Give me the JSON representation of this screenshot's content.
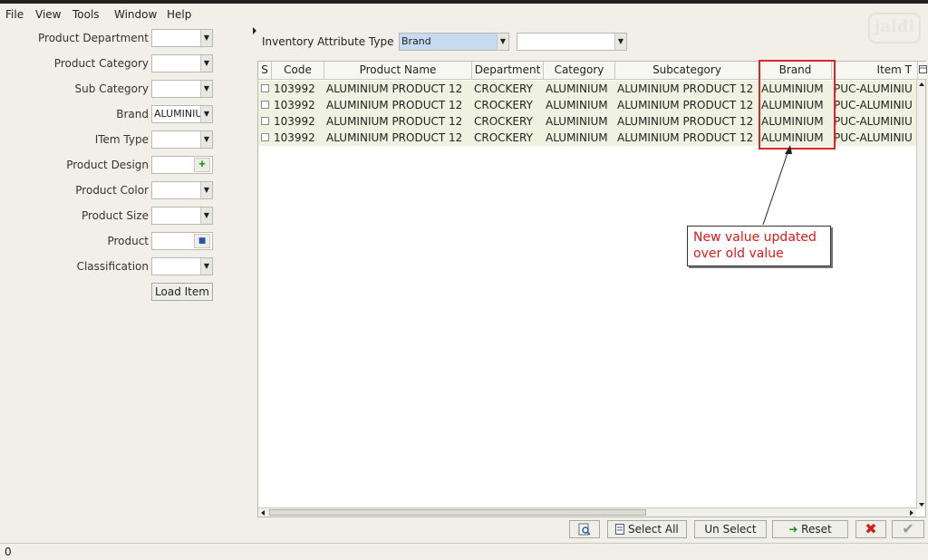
{
  "menu": [
    "File",
    "View",
    "Tools",
    "Window",
    "Help"
  ],
  "logo_text": "jaldi",
  "filters": [
    {
      "label": "Product Department",
      "value": "",
      "kind": "combo"
    },
    {
      "label": "Product Category",
      "value": "",
      "kind": "combo"
    },
    {
      "label": "Sub Category",
      "value": "",
      "kind": "combo"
    },
    {
      "label": "Brand",
      "value": "ALUMINIU",
      "kind": "combo"
    },
    {
      "label": "ITem Type",
      "value": "",
      "kind": "combo"
    },
    {
      "label": "Product Design",
      "value": "",
      "kind": "picker"
    },
    {
      "label": "Product Color",
      "value": "",
      "kind": "combo"
    },
    {
      "label": "Product Size",
      "value": "",
      "kind": "combo"
    },
    {
      "label": "Product",
      "value": "",
      "kind": "picker"
    },
    {
      "label": "Classification",
      "value": "",
      "kind": "combo"
    }
  ],
  "load_item_label": "Load Item",
  "attribute_type": {
    "label": "Inventory Attribute Type",
    "value": "Brand",
    "second_value": ""
  },
  "grid": {
    "columns": [
      "S",
      "Code",
      "Product Name",
      "Department",
      "Category",
      "Subcategory",
      "Brand",
      "Item T"
    ],
    "rows": [
      [
        "",
        "103992",
        "ALUMINIUM PRODUCT 12",
        "CROCKERY",
        "ALUMINIUM",
        "ALUMINIUM PRODUCT 12",
        "ALUMINIUM",
        "PUC-ALUMINIU"
      ],
      [
        "",
        "103992",
        "ALUMINIUM PRODUCT 12",
        "CROCKERY",
        "ALUMINIUM",
        "ALUMINIUM PRODUCT 12",
        "ALUMINIUM",
        "PUC-ALUMINIU"
      ],
      [
        "",
        "103992",
        "ALUMINIUM PRODUCT 12",
        "CROCKERY",
        "ALUMINIUM",
        "ALUMINIUM PRODUCT 12",
        "ALUMINIUM",
        "PUC-ALUMINIU"
      ],
      [
        "",
        "103992",
        "ALUMINIUM PRODUCT 12",
        "CROCKERY",
        "ALUMINIUM",
        "ALUMINIUM PRODUCT 12",
        "ALUMINIUM",
        "PUC-ALUMINIU"
      ]
    ]
  },
  "annotation": {
    "line1": "New value updated",
    "line2": "over old value"
  },
  "buttons": {
    "select_all": "Select All",
    "unselect": "Un Select",
    "reset": "Reset"
  },
  "status_text": "0",
  "colors": {
    "highlight": "#d92626",
    "annotation_text": "#e01818",
    "row_bg": "#eff2e1",
    "selected_combo": "#c8daf2"
  },
  "icons": [
    "search-icon",
    "select-all-icon",
    "reset-icon",
    "cancel-icon",
    "ok-icon"
  ]
}
